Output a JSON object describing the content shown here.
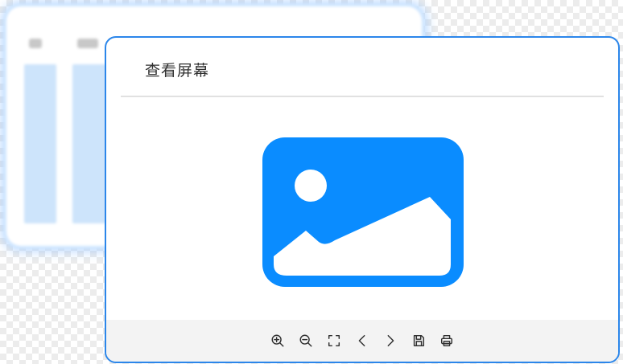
{
  "viewer": {
    "title": "查看屏幕",
    "placeholder_icon": "image-placeholder-icon",
    "accent_color": "#0a8cff",
    "border_color": "#2b86ea"
  },
  "toolbar": {
    "buttons": [
      {
        "name": "zoom-in",
        "icon": "zoom-in-icon"
      },
      {
        "name": "zoom-out",
        "icon": "zoom-out-icon"
      },
      {
        "name": "fullscreen",
        "icon": "fullscreen-icon"
      },
      {
        "name": "previous",
        "icon": "chevron-left-icon"
      },
      {
        "name": "next",
        "icon": "chevron-right-icon"
      },
      {
        "name": "save",
        "icon": "save-icon"
      },
      {
        "name": "print",
        "icon": "print-icon"
      }
    ]
  },
  "background_window": {
    "style": "blurred table preview"
  }
}
